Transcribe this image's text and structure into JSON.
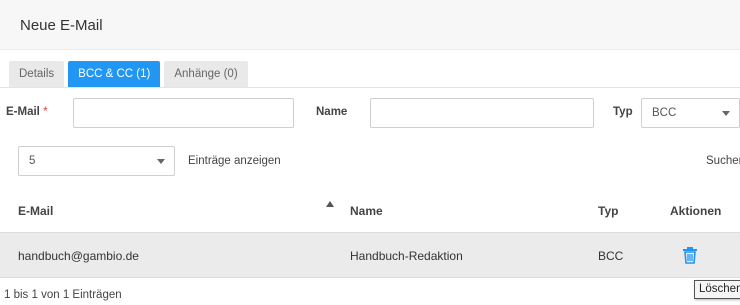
{
  "header": {
    "title": "Neue E-Mail"
  },
  "tabs": [
    {
      "label": "Details"
    },
    {
      "label": "BCC & CC (1)"
    },
    {
      "label": "Anhänge (0)"
    }
  ],
  "form": {
    "email_label": "E-Mail",
    "email_required_mark": "*",
    "email_value": "",
    "name_label": "Name",
    "name_value": "",
    "type_label": "Typ",
    "type_value": "BCC"
  },
  "table_controls": {
    "page_size_value": "5",
    "page_size_suffix": "Einträge anzeigen",
    "search_label": "Suchen"
  },
  "table": {
    "columns": [
      "E-Mail",
      "Name",
      "Typ",
      "Aktionen"
    ],
    "rows": [
      {
        "email": "handbuch@gambio.de",
        "name": "Handbuch-Redaktion",
        "type": "BCC",
        "action_icon": "trash-icon"
      }
    ]
  },
  "footer": {
    "info": "1 bis 1 von 1 Einträgen"
  },
  "tooltip": {
    "text": "Löschen"
  },
  "colors": {
    "accent": "#2196f3",
    "row_bg": "#ebebeb",
    "header_bg": "#f7f7f7"
  }
}
